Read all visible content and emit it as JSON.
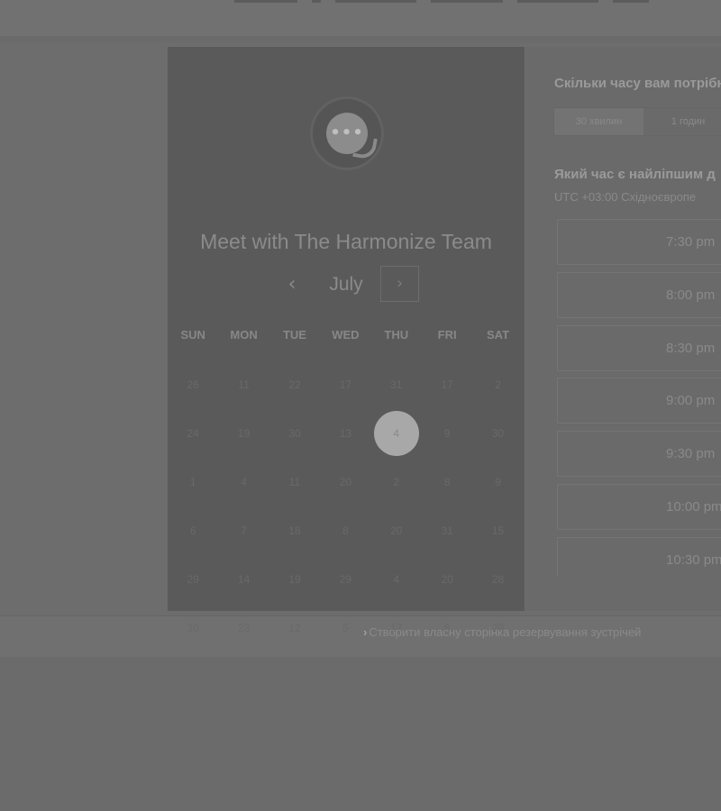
{
  "calendar": {
    "title": "Meet with The Harmonize Team",
    "logo_glyph": "•••",
    "month": "July",
    "prev_icon": "‹",
    "next_icon": "›",
    "weekdays": [
      "SUN",
      "MON",
      "TUE",
      "WED",
      "THU",
      "FRI",
      "SAT"
    ],
    "days": [
      "26",
      "11",
      "22",
      "17",
      "31",
      "17",
      "2",
      "24",
      "19",
      "30",
      "13",
      "4",
      "9",
      "30",
      "1",
      "4",
      "11",
      "20",
      "2",
      "8",
      "9",
      "6",
      "7",
      "18",
      "8",
      "20",
      "31",
      "15",
      "29",
      "14",
      "19",
      "29",
      "4",
      "20",
      "28",
      "30",
      "23",
      "12",
      "5",
      "17",
      "8",
      "29"
    ],
    "selected_day": "4"
  },
  "booking": {
    "duration_question": "Скільки часу вам потрібн",
    "durations": [
      "30 хвилин",
      "1 годин"
    ],
    "time_question": "Який час є найліпшим д",
    "timezone": "UTC +03:00 Східноєвропе",
    "time_slots": [
      "7:30 pm",
      "8:00 pm",
      "8:30 pm",
      "9:00 pm",
      "9:30 pm",
      "10:00 pm",
      "10:30 pm"
    ]
  },
  "footer": {
    "create_link": "Створити власну сторінка резервування зустрічей",
    "create_link_icon": "›"
  },
  "colors": {
    "overlay": "#6b6b6b",
    "calendar_panel": "#5a5a5a",
    "selected_day": "#a8a8a8"
  }
}
